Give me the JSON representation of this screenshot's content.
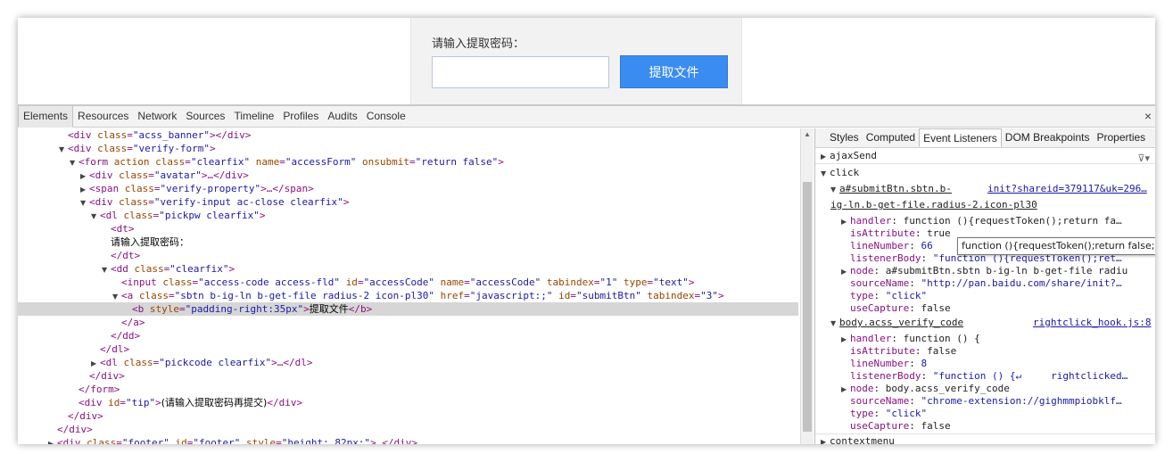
{
  "page": {
    "password_label": "请输入提取密码：",
    "password_value": "",
    "submit_label": "提取文件"
  },
  "devtools": {
    "tabs": [
      "Elements",
      "Resources",
      "Network",
      "Sources",
      "Timeline",
      "Profiles",
      "Audits",
      "Console"
    ],
    "active_tab": "Elements",
    "close_glyph": "×"
  },
  "side_panel": {
    "tabs": [
      "Styles",
      "Computed",
      "Event Listeners",
      "DOM Breakpoints",
      "Properties"
    ],
    "active_tab": "Event Listeners",
    "events": {
      "ajaxSend": "ajaxSend",
      "click": "click",
      "contextmenu": "contextmenu"
    },
    "listener1": {
      "node_line1": "a#submitBtn.sbtn.b-",
      "node_line2": "ig-ln.b-get-file.radius-2.icon-pl30",
      "source_link": "init?shareid=379117&uk=296…",
      "handler": "function (){requestToken();return fa…",
      "isAttribute": "true",
      "lineNumber": "66",
      "listenerBody": "\"function (){requestToken();ret…",
      "node": "a#submitBtn.sbtn b-ig-ln b-get-file radiu",
      "sourceName": "\"http://pan.baidu.com/share/init?…",
      "type": "\"click\"",
      "useCapture": "false"
    },
    "listener2": {
      "node_line": "body.acss_verify_code",
      "source_link": "rightclick_hook.js:8",
      "handler": "function () {",
      "isAttribute": "false",
      "lineNumber": "8",
      "listenerBody": "\"function () {↵     rightclicked…",
      "node": "body.acss_verify_code",
      "sourceName": "\"chrome-extension://gighmmpiobklf…",
      "type": "\"click\"",
      "useCapture": "false"
    },
    "tooltip": "function (){requestToken();return false;}"
  },
  "tree": {
    "l01": {
      "attr1": "class",
      "val1": "\"acss_banner\""
    },
    "l02": {
      "attr1": "class",
      "val1": "\"verify-form\""
    },
    "l03": {
      "attr1": "action",
      "attr2": "class",
      "val2": "\"clearfix\"",
      "attr3": "name",
      "val3": "\"accessForm\"",
      "attr4": "onsubmit",
      "val4": "\"return false\""
    },
    "l04": {
      "attr1": "class",
      "val1": "\"avatar\""
    },
    "l05": {
      "attr1": "class",
      "val1": "\"verify-property\""
    },
    "l06": {
      "attr1": "class",
      "val1": "\"verify-input ac-close clearfix\""
    },
    "l07": {
      "attr1": "class",
      "val1": "\"pickpw clearfix\""
    },
    "l09": {
      "text": "请输入提取密码："
    },
    "l11": {
      "attr1": "class",
      "val1": "\"clearfix\""
    },
    "l12": {
      "attr1": "class",
      "val1": "\"access-code access-fld\"",
      "attr2": "id",
      "val2": "\"accessCode\"",
      "attr3": "name",
      "val3": "\"accessCode\"",
      "attr4": "tabindex",
      "val4": "\"1\"",
      "attr5": "type",
      "val5": "\"text\""
    },
    "l13": {
      "attr1": "class",
      "val1": "\"sbtn b-ig-ln b-get-file radius-2 icon-pl30\"",
      "attr2": "href",
      "val2": "\"javascript:;\"",
      "attr3": "id",
      "val3": "\"submitBtn\"",
      "attr4": "tabindex",
      "val4": "\"3\""
    },
    "l14": {
      "attr1": "style",
      "val1": "\"padding-right:35px\"",
      "text": "提取文件"
    },
    "l18": {
      "attr1": "class",
      "val1": "\"pickcode clearfix\""
    },
    "l21": {
      "attr1": "id",
      "val1": "\"tip\"",
      "text": "(请输入提取密码再提交)"
    },
    "l24": {
      "attr1": "class",
      "val1": "\"footer\"",
      "attr2": "id",
      "val2": "\"footer\"",
      "attr3": "style",
      "val3": "\"height: 82px;\""
    }
  }
}
